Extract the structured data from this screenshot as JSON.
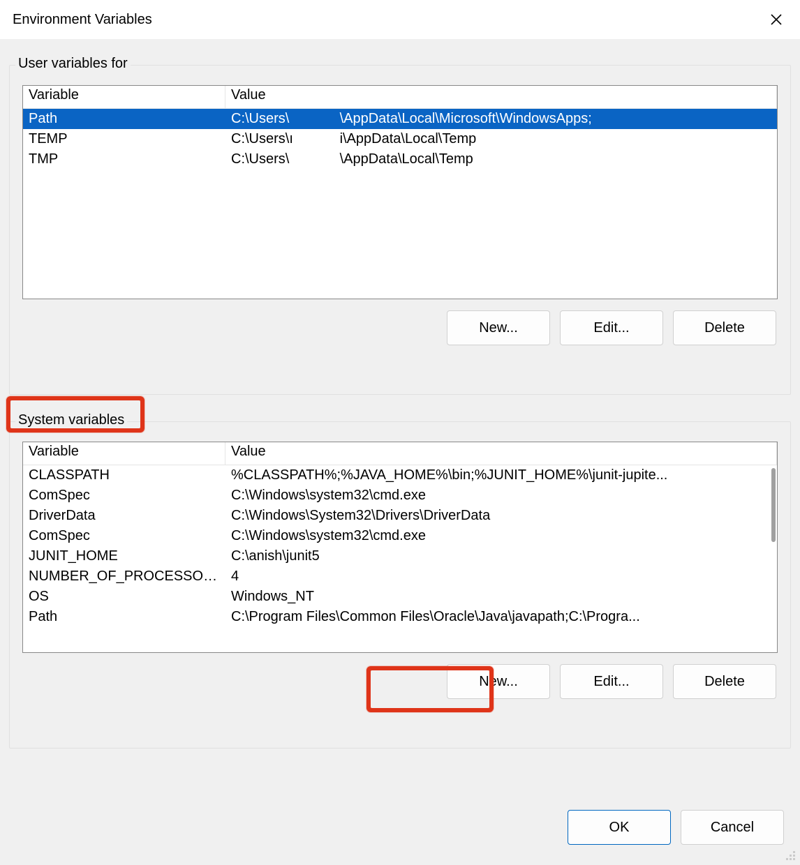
{
  "dialog": {
    "title": "Environment Variables"
  },
  "user_group": {
    "legend": "User variables for",
    "headers": {
      "variable": "Variable",
      "value": "Value"
    },
    "rows": [
      {
        "variable": "Path",
        "value": "C:\\Users\\             \\AppData\\Local\\Microsoft\\WindowsApps;",
        "selected": true
      },
      {
        "variable": "TEMP",
        "value": "C:\\Users\\ı            i\\AppData\\Local\\Temp",
        "selected": false
      },
      {
        "variable": "TMP",
        "value": "C:\\Users\\             \\AppData\\Local\\Temp",
        "selected": false
      }
    ],
    "buttons": {
      "new": "New...",
      "edit": "Edit...",
      "delete": "Delete"
    }
  },
  "system_group": {
    "legend": "System variables",
    "headers": {
      "variable": "Variable",
      "value": "Value"
    },
    "rows": [
      {
        "variable": "CLASSPATH",
        "value": "%CLASSPATH%;%JAVA_HOME%\\bin;%JUNIT_HOME%\\junit-jupite..."
      },
      {
        "variable": "ComSpec",
        "value": "C:\\Windows\\system32\\cmd.exe"
      },
      {
        "variable": "DriverData",
        "value": "C:\\Windows\\System32\\Drivers\\DriverData"
      },
      {
        "variable": "ComSpec",
        "value": "C:\\Windows\\system32\\cmd.exe"
      },
      {
        "variable": "JUNIT_HOME",
        "value": "C:\\anish\\junit5"
      },
      {
        "variable": "NUMBER_OF_PROCESSORS",
        "value": "4"
      },
      {
        "variable": "OS",
        "value": "Windows_NT"
      },
      {
        "variable": "Path",
        "value": "C:\\Program Files\\Common Files\\Oracle\\Java\\javapath;C:\\Progra..."
      }
    ],
    "buttons": {
      "new": "New...",
      "edit": "Edit...",
      "delete": "Delete"
    }
  },
  "dialog_buttons": {
    "ok": "OK",
    "cancel": "Cancel"
  }
}
